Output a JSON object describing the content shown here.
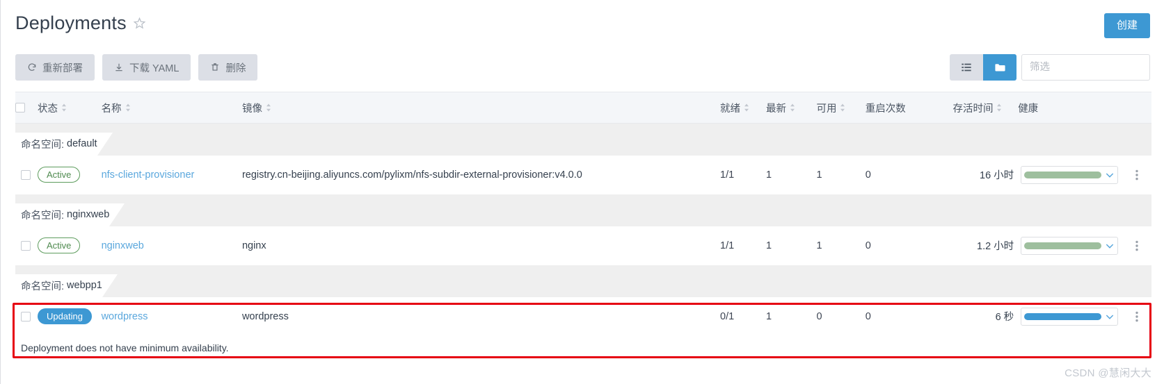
{
  "header": {
    "title": "Deployments",
    "star_icon": "star-outline-icon",
    "create_button": "创建"
  },
  "toolbar": {
    "redeploy": "重新部署",
    "download_yaml": "下载 YAML",
    "delete": "删除",
    "redeploy_icon": "refresh-icon",
    "download_icon": "download-icon",
    "delete_icon": "trash-icon",
    "view_list_icon": "list-view-icon",
    "view_group_icon": "folder-group-icon",
    "filter_placeholder": "筛选",
    "filter_value": ""
  },
  "table": {
    "columns": [
      {
        "label": "状态",
        "sortable": true
      },
      {
        "label": "名称",
        "sortable": true
      },
      {
        "label": "镜像",
        "sortable": true
      },
      {
        "label": "就绪",
        "sortable": true
      },
      {
        "label": "最新",
        "sortable": true
      },
      {
        "label": "可用",
        "sortable": true
      },
      {
        "label": "重启次数",
        "sortable": false
      },
      {
        "label": "存活时间",
        "sortable": true
      },
      {
        "label": "健康",
        "sortable": false
      }
    ],
    "namespace_label": "命名空间:",
    "groups": [
      {
        "namespace": "default",
        "rows": [
          {
            "status": "Active",
            "status_kind": "active",
            "name": "nfs-client-provisioner",
            "image": "registry.cn-beijing.aliyuncs.com/pylixm/nfs-subdir-external-provisioner:v4.0.0",
            "ready": "1/1",
            "uptodate": "1",
            "available": "1",
            "restarts": "0",
            "age": "16 小时",
            "health_color": "green",
            "message": ""
          }
        ]
      },
      {
        "namespace": "nginxweb",
        "rows": [
          {
            "status": "Active",
            "status_kind": "active",
            "name": "nginxweb",
            "image": "nginx",
            "ready": "1/1",
            "uptodate": "1",
            "available": "1",
            "restarts": "0",
            "age": "1.2 小时",
            "health_color": "green",
            "message": ""
          }
        ]
      },
      {
        "namespace": "webpp1",
        "rows": [
          {
            "status": "Updating",
            "status_kind": "updating",
            "name": "wordpress",
            "image": "wordpress",
            "ready": "0/1",
            "uptodate": "1",
            "available": "0",
            "restarts": "0",
            "age": "6 秒",
            "health_color": "blue",
            "message": "Deployment does not have minimum availability."
          }
        ]
      }
    ]
  },
  "annotation": {
    "highlight_color": "#e60012"
  },
  "watermark": "CSDN @慧闲大大",
  "colors": {
    "accent_blue": "#3d98d3",
    "link_blue": "#5aa7dd",
    "active_green": "#4f8a4f",
    "health_green": "#9ebf9e",
    "toolbar_gray": "#dcdfe6",
    "header_bg": "#f4f6f9",
    "band_gray": "#efefef"
  }
}
